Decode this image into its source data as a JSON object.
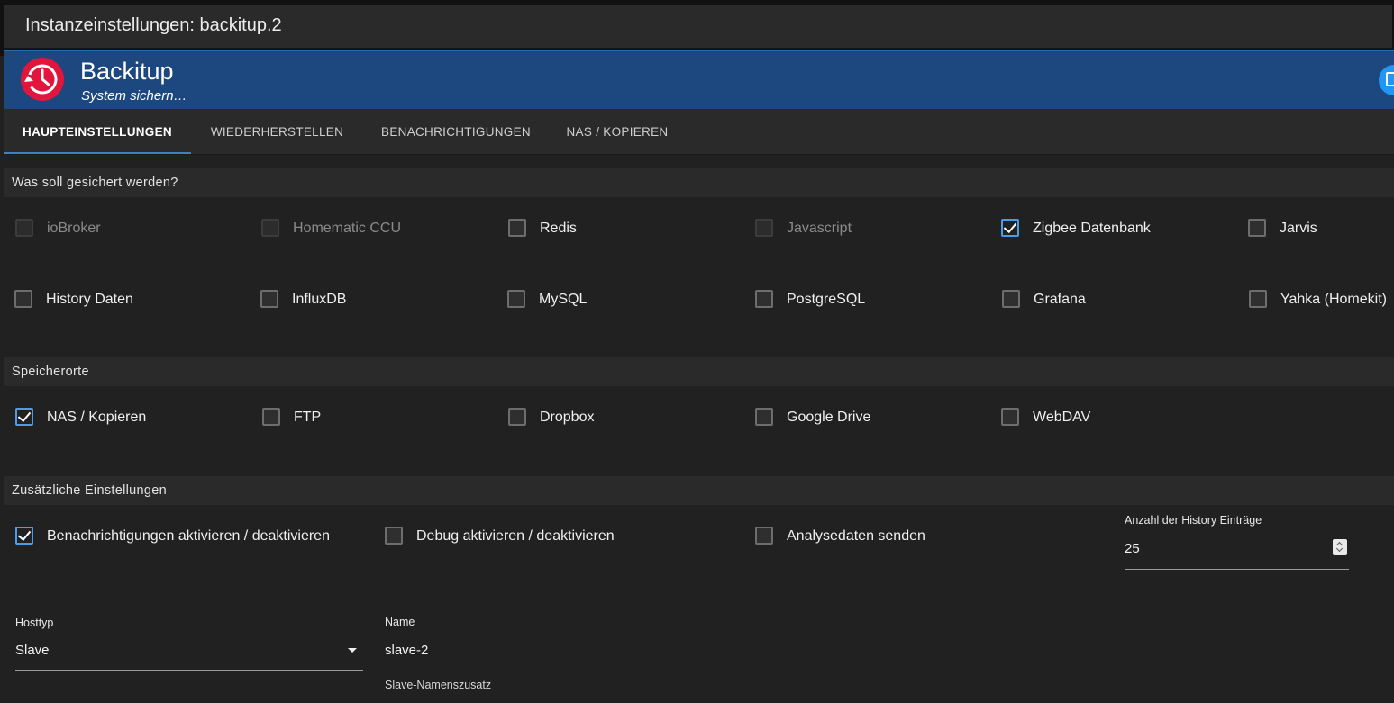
{
  "window": {
    "title": "Instanzeinstellungen: backitup.2"
  },
  "app": {
    "name": "Backitup",
    "subtitle": "System sichern…",
    "logo_icon": "history-clock-icon",
    "logo_color": "#e2163d"
  },
  "tabs": [
    {
      "label": "HAUPTEINSTELLUNGEN",
      "active": true
    },
    {
      "label": "WIEDERHERSTELLEN",
      "active": false
    },
    {
      "label": "BENACHRICHTIGUNGEN",
      "active": false
    },
    {
      "label": "NAS / KOPIEREN",
      "active": false
    }
  ],
  "sections": {
    "backup_what": {
      "title": "Was soll gesichert werden?",
      "items": [
        {
          "label": "ioBroker",
          "checked": false,
          "disabled": true
        },
        {
          "label": "Homematic CCU",
          "checked": false,
          "disabled": true
        },
        {
          "label": "Redis",
          "checked": false,
          "disabled": false
        },
        {
          "label": "Javascript",
          "checked": false,
          "disabled": true
        },
        {
          "label": "Zigbee Datenbank",
          "checked": true,
          "disabled": false
        },
        {
          "label": "Jarvis",
          "checked": false,
          "disabled": false
        },
        {
          "label": "History Daten",
          "checked": false,
          "disabled": false
        },
        {
          "label": "InfluxDB",
          "checked": false,
          "disabled": false
        },
        {
          "label": "MySQL",
          "checked": false,
          "disabled": false
        },
        {
          "label": "PostgreSQL",
          "checked": false,
          "disabled": false
        },
        {
          "label": "Grafana",
          "checked": false,
          "disabled": false
        },
        {
          "label": "Yahka (Homekit)",
          "checked": false,
          "disabled": false
        }
      ]
    },
    "storage": {
      "title": "Speicherorte",
      "items": [
        {
          "label": "NAS / Kopieren",
          "checked": true
        },
        {
          "label": "FTP",
          "checked": false
        },
        {
          "label": "Dropbox",
          "checked": false
        },
        {
          "label": "Google Drive",
          "checked": false
        },
        {
          "label": "WebDAV",
          "checked": false
        }
      ]
    },
    "extra": {
      "title": "Zusätzliche Einstellungen",
      "items": [
        {
          "label": "Benachrichtigungen aktivieren / deaktivieren",
          "checked": true
        },
        {
          "label": "Debug aktivieren / deaktivieren",
          "checked": false
        },
        {
          "label": "Analysedaten senden",
          "checked": false
        }
      ],
      "history_count": {
        "label": "Anzahl der History Einträge",
        "value": "25"
      },
      "hosttype": {
        "label": "Hosttyp",
        "value": "Slave"
      },
      "name": {
        "label": "Name",
        "value": "slave-2",
        "helper": "Slave-Namenszusatz"
      }
    }
  },
  "colors": {
    "accent": "#4a9de8",
    "banner": "#1c477f",
    "background": "#212121"
  }
}
